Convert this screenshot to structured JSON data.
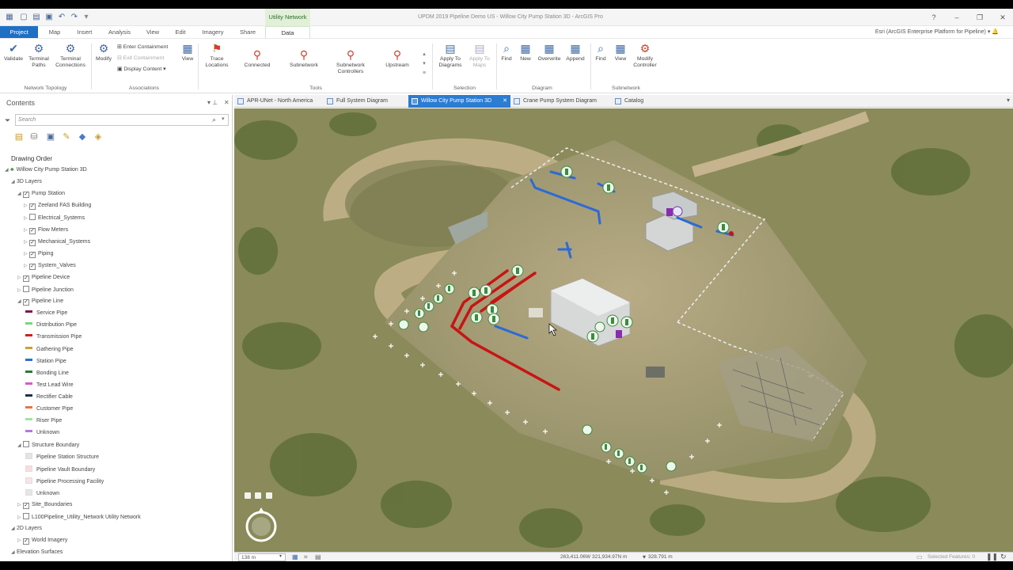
{
  "window": {
    "title": "UPDM 2019 Pipeline Demo US - Willow City Pump Station 3D - ArcGIS Pro",
    "context_tab": "Utility Network",
    "user": "Esri (ArcGIS Enterprise Platform for Pipeline)",
    "help": "?"
  },
  "ribbon_tabs": [
    "Project",
    "Map",
    "Insert",
    "Analysis",
    "View",
    "Edit",
    "Imagery",
    "Share",
    "Data"
  ],
  "ribbon": {
    "validate": "Validate",
    "terminal_paths": "Terminal Paths",
    "terminal_connections": "Terminal Connections",
    "modify": "Modify",
    "enter_containment": "Enter Containment",
    "exit_containment": "Exit Containment",
    "display_content": "Display Content",
    "view": "View",
    "trace_locations": "Trace Locations",
    "connected": "Connected",
    "subnetwork": "Subnetwork",
    "subnetwork_controllers": "Subnetwork Controllers",
    "upstream": "Upstream",
    "apply_to_diagrams": "Apply To Diagrams",
    "apply_to_maps": "Apply To Maps",
    "find": "Find",
    "new": "New",
    "overwrite": "Overwrite",
    "append": "Append",
    "find2": "Find",
    "view2": "View",
    "modify_controller": "Modify Controller",
    "groups": {
      "network_topology": "Network Topology",
      "associations": "Associations",
      "tools": "Tools",
      "selection": "Selection",
      "diagram": "Diagram",
      "subnetwork": "Subnetwork"
    }
  },
  "contents": {
    "title": "Contents",
    "search_placeholder": "Search",
    "drawing_order": "Drawing Order",
    "tree": [
      {
        "label": "Willow City Pump Station 3D",
        "indent": 0,
        "type": "map"
      },
      {
        "label": "3D Layers",
        "indent": 1,
        "type": "group"
      },
      {
        "label": "Pump Station",
        "indent": 2,
        "type": "check",
        "checked": true,
        "expanded": true
      },
      {
        "label": "Zeeland FAS Building",
        "indent": 3,
        "type": "check",
        "checked": true
      },
      {
        "label": "Electrical_Systems",
        "indent": 3,
        "type": "check",
        "checked": false
      },
      {
        "label": "Flow Meters",
        "indent": 3,
        "type": "check",
        "checked": true
      },
      {
        "label": "Mechanical_Systems",
        "indent": 3,
        "type": "check",
        "checked": true
      },
      {
        "label": "Piping",
        "indent": 3,
        "type": "check",
        "checked": true
      },
      {
        "label": "System_Valves",
        "indent": 3,
        "type": "check",
        "checked": true
      },
      {
        "label": "Pipeline Device",
        "indent": 2,
        "type": "check",
        "checked": true
      },
      {
        "label": "Pipeline Junction",
        "indent": 2,
        "type": "check",
        "checked": false
      },
      {
        "label": "Pipeline Line",
        "indent": 2,
        "type": "check",
        "checked": true,
        "expanded": true
      },
      {
        "label": "Service Pipe",
        "indent": 4,
        "type": "line",
        "color": "#7b1a4a"
      },
      {
        "label": "Distribution Pipe",
        "indent": 4,
        "type": "line",
        "color": "#7fd37a"
      },
      {
        "label": "Transmission Pipe",
        "indent": 4,
        "type": "line",
        "color": "#d11f1f"
      },
      {
        "label": "Gathering Pipe",
        "indent": 4,
        "type": "line",
        "color": "#c9a233"
      },
      {
        "label": "Station Pipe",
        "indent": 4,
        "type": "line",
        "color": "#2e6fd1"
      },
      {
        "label": "Bonding Line",
        "indent": 4,
        "type": "line",
        "color": "#2a7a3a"
      },
      {
        "label": "Test Lead Wire",
        "indent": 4,
        "type": "line",
        "color": "#d65cc4"
      },
      {
        "label": "Rectifier Cable",
        "indent": 4,
        "type": "line",
        "color": "#2b2b4a"
      },
      {
        "label": "Customer Pipe",
        "indent": 4,
        "type": "line",
        "color": "#e8734a"
      },
      {
        "label": "Riser Pipe",
        "indent": 4,
        "type": "line",
        "color": "#a8e0a0"
      },
      {
        "label": "Unknown",
        "indent": 4,
        "type": "line",
        "color": "#b07bd6"
      },
      {
        "label": "Structure Boundary",
        "indent": 2,
        "type": "check",
        "checked": false,
        "expanded": true
      },
      {
        "label": "Pipeline Station Structure",
        "indent": 4,
        "type": "fill",
        "color": "#e4e4e4"
      },
      {
        "label": "Pipeline Vault Boundary",
        "indent": 4,
        "type": "fill",
        "color": "#f6dede"
      },
      {
        "label": "Pipeline Processing Facility",
        "indent": 4,
        "type": "fill",
        "color": "#f8e4e4"
      },
      {
        "label": "Unknown",
        "indent": 4,
        "type": "fill",
        "color": "#e6e6e6"
      },
      {
        "label": "Site_Boundaries",
        "indent": 2,
        "type": "check",
        "checked": true
      },
      {
        "label": "L100Pipeline_Utility_Network Utility Network",
        "indent": 2,
        "type": "check",
        "checked": false
      },
      {
        "label": "2D Layers",
        "indent": 1,
        "type": "group"
      },
      {
        "label": "World Imagery",
        "indent": 2,
        "type": "check",
        "checked": true
      },
      {
        "label": "Elevation Surfaces",
        "indent": 1,
        "type": "group"
      },
      {
        "label": "Ground",
        "indent": 2,
        "type": "group"
      },
      {
        "label": "WorldElevation3D/Terrain3D",
        "indent": 3,
        "type": "check",
        "checked": true
      }
    ]
  },
  "doc_tabs": [
    {
      "label": "APR-UNet - North America",
      "active": false
    },
    {
      "label": "Full System Diagram",
      "active": false
    },
    {
      "label": "Willow City Pump Station 3D",
      "active": true
    },
    {
      "label": "Crane Pump System Diagram",
      "active": false
    },
    {
      "label": "Catalog",
      "active": false
    }
  ],
  "status": {
    "scale": "138 m",
    "coords": "263,411.06W 321,934.97N m",
    "elevation": "328.791 m",
    "selected": "Selected Features: 0"
  }
}
